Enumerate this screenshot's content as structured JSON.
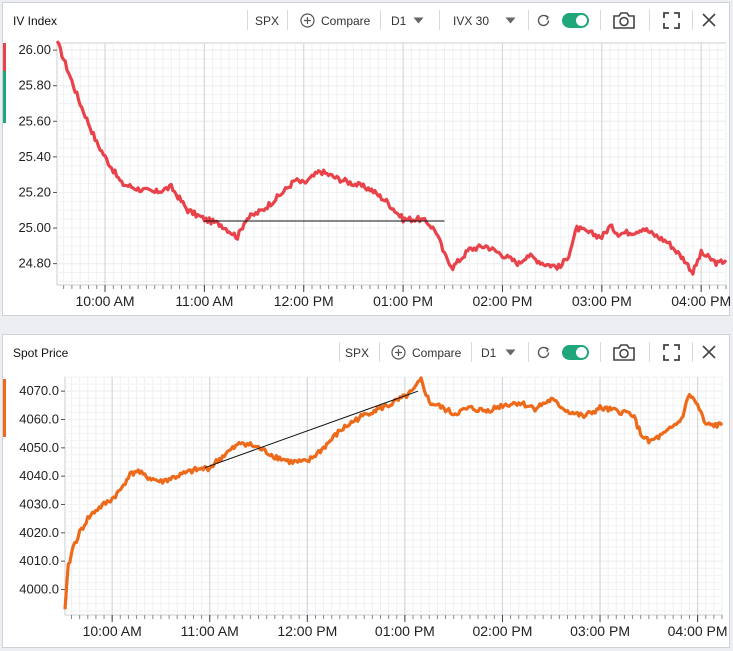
{
  "panels": [
    {
      "title": "IV Index",
      "symbol": "SPX",
      "compare_label": "Compare",
      "timeframe": "D1",
      "metric": "IVX 30",
      "toggle_on": true,
      "series_color": "#e8424a",
      "y_ticks": [
        "26.00",
        "25.80",
        "25.60",
        "25.40",
        "25.20",
        "25.00",
        "24.80"
      ],
      "x_ticks": [
        "10:00 AM",
        "11:00 AM",
        "12:00 PM",
        "01:00 PM",
        "02:00 PM",
        "03:00 PM",
        "04:00 PM"
      ]
    },
    {
      "title": "Spot Price",
      "symbol": "SPX",
      "compare_label": "Compare",
      "timeframe": "D1",
      "series_color": "#ee6a1b",
      "y_ticks": [
        "4070.0",
        "4060.0",
        "4050.0",
        "4040.0",
        "4030.0",
        "4020.0",
        "4010.0",
        "4000.0"
      ],
      "x_ticks": [
        "10:00 AM",
        "11:00 AM",
        "12:00 PM",
        "01:00 PM",
        "02:00 PM",
        "03:00 PM",
        "04:00 PM"
      ]
    }
  ],
  "chart_data": [
    {
      "type": "line",
      "title": "IV Index",
      "series": [
        {
          "name": "IVX 30",
          "color": "#e8424a"
        }
      ],
      "x": [
        "09:31",
        "09:35",
        "09:45",
        "09:55",
        "10:00",
        "10:10",
        "10:20",
        "10:30",
        "10:40",
        "10:50",
        "11:00",
        "11:10",
        "11:20",
        "11:25",
        "11:35",
        "11:45",
        "11:55",
        "12:00",
        "12:10",
        "12:20",
        "12:30",
        "12:40",
        "12:50",
        "13:00",
        "13:10",
        "13:15",
        "13:20",
        "13:25",
        "13:30",
        "13:40",
        "13:50",
        "14:00",
        "14:10",
        "14:15",
        "14:25",
        "14:35",
        "14:40",
        "14:45",
        "14:50",
        "15:00",
        "15:05",
        "15:10",
        "15:20",
        "15:25",
        "15:30",
        "15:40",
        "15:50",
        "15:55",
        "16:00",
        "16:10",
        "16:15"
      ],
      "y": [
        26.05,
        25.95,
        25.7,
        25.48,
        25.4,
        25.25,
        25.22,
        25.2,
        25.23,
        25.1,
        25.05,
        25.02,
        24.95,
        25.05,
        25.1,
        25.18,
        25.27,
        25.25,
        25.32,
        25.28,
        25.25,
        25.22,
        25.15,
        25.05,
        25.05,
        25.03,
        24.98,
        24.85,
        24.78,
        24.88,
        24.9,
        24.85,
        24.8,
        24.85,
        24.8,
        24.78,
        24.85,
        25.0,
        24.98,
        24.95,
        25.01,
        24.97,
        24.98,
        25.0,
        24.97,
        24.92,
        24.82,
        24.75,
        24.86,
        24.8,
        24.82
      ],
      "annotations": [
        {
          "type": "trendline",
          "from": [
            "11:00",
            25.04
          ],
          "to": [
            "13:25",
            25.04
          ]
        }
      ],
      "ylim": [
        24.68,
        26.04
      ],
      "xlim": [
        "09:31",
        "16:15"
      ],
      "grid": true
    },
    {
      "type": "line",
      "title": "Spot Price",
      "series": [
        {
          "name": "SPX",
          "color": "#ee6a1b"
        }
      ],
      "x": [
        "09:31",
        "09:33",
        "09:36",
        "09:40",
        "09:45",
        "09:50",
        "09:55",
        "10:00",
        "10:05",
        "10:10",
        "10:15",
        "10:20",
        "10:30",
        "10:40",
        "10:50",
        "11:00",
        "11:10",
        "11:20",
        "11:30",
        "11:40",
        "11:50",
        "12:00",
        "12:10",
        "12:20",
        "12:30",
        "12:40",
        "12:50",
        "13:00",
        "13:05",
        "13:10",
        "13:15",
        "13:20",
        "13:30",
        "13:40",
        "13:50",
        "14:00",
        "14:10",
        "14:20",
        "14:30",
        "14:40",
        "14:50",
        "15:00",
        "15:10",
        "15:20",
        "15:25",
        "15:30",
        "15:40",
        "15:50",
        "15:55",
        "16:00",
        "16:05",
        "16:15"
      ],
      "y": [
        3993,
        4008,
        4015,
        4020,
        4025,
        4028,
        4030,
        4032,
        4035,
        4040,
        4042,
        4040,
        4038,
        4040,
        4042,
        4043,
        4048,
        4052,
        4050,
        4047,
        4045,
        4045,
        4050,
        4056,
        4060,
        4063,
        4065,
        4068,
        4070,
        4074,
        4066,
        4065,
        4062,
        4064,
        4063,
        4065,
        4066,
        4064,
        4067,
        4063,
        4061,
        4064,
        4063,
        4062,
        4055,
        4052,
        4055,
        4060,
        4069,
        4065,
        4058,
        4058
      ],
      "annotations": [
        {
          "type": "trendline",
          "from": [
            "10:57",
            4043
          ],
          "to": [
            "13:08",
            4070
          ]
        }
      ],
      "ylim": [
        3991,
        4075
      ],
      "xlim": [
        "09:31",
        "16:15"
      ],
      "grid": true
    }
  ]
}
